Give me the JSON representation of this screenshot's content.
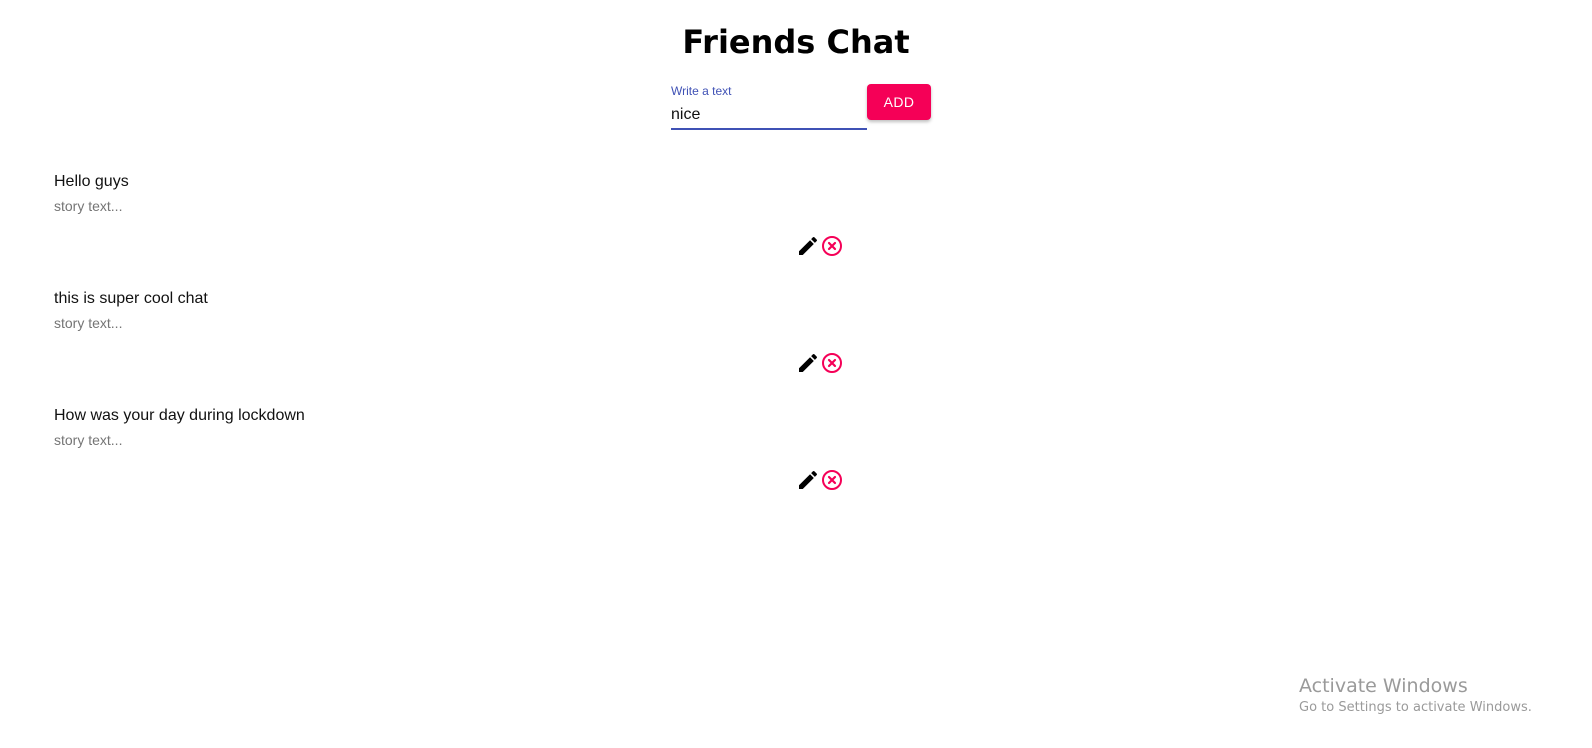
{
  "header": {
    "title": "Friends Chat"
  },
  "compose": {
    "label": "Write a text",
    "value": "nice",
    "add_label": "ADD"
  },
  "messages": [
    {
      "text": "Hello guys",
      "secondary": "story text..."
    },
    {
      "text": "this is super cool chat",
      "secondary": "story text..."
    },
    {
      "text": "How was your day during lockdown",
      "secondary": "story text..."
    }
  ],
  "icons": {
    "edit": "pencil-icon",
    "delete": "cancel-circle-icon"
  },
  "colors": {
    "primary": "#3f51b5",
    "secondary": "#f50057"
  },
  "watermark": {
    "title": "Activate Windows",
    "subtitle": "Go to Settings to activate Windows."
  }
}
